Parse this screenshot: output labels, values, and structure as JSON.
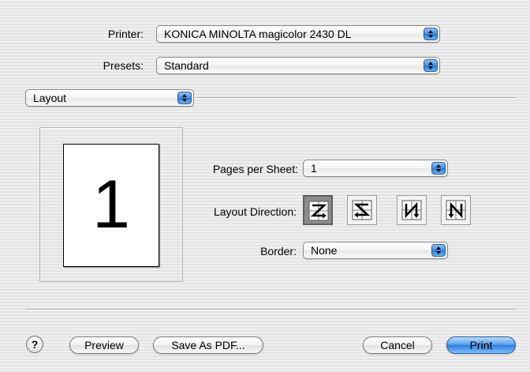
{
  "printer": {
    "label": "Printer:",
    "value": "KONICA MINOLTA magicolor 2430 DL"
  },
  "presets": {
    "label": "Presets:",
    "value": "Standard"
  },
  "panel": {
    "value": "Layout"
  },
  "preview": {
    "page_number": "1"
  },
  "pages_per_sheet": {
    "label": "Pages per Sheet:",
    "value": "1"
  },
  "layout_direction": {
    "label": "Layout Direction:",
    "options": [
      {
        "icon": "z-order-icon",
        "selected": true
      },
      {
        "icon": "reverse-z-order-icon",
        "selected": false
      },
      {
        "icon": "n-order-icon",
        "selected": false
      },
      {
        "icon": "reverse-n-order-icon",
        "selected": false
      }
    ]
  },
  "border": {
    "label": "Border:",
    "value": "None"
  },
  "buttons": {
    "help": "?",
    "preview": "Preview",
    "save_pdf": "Save As PDF...",
    "cancel": "Cancel",
    "print": "Print"
  },
  "colors": {
    "accent": "#3f8fe0",
    "default_button": "#5ba3ef"
  }
}
